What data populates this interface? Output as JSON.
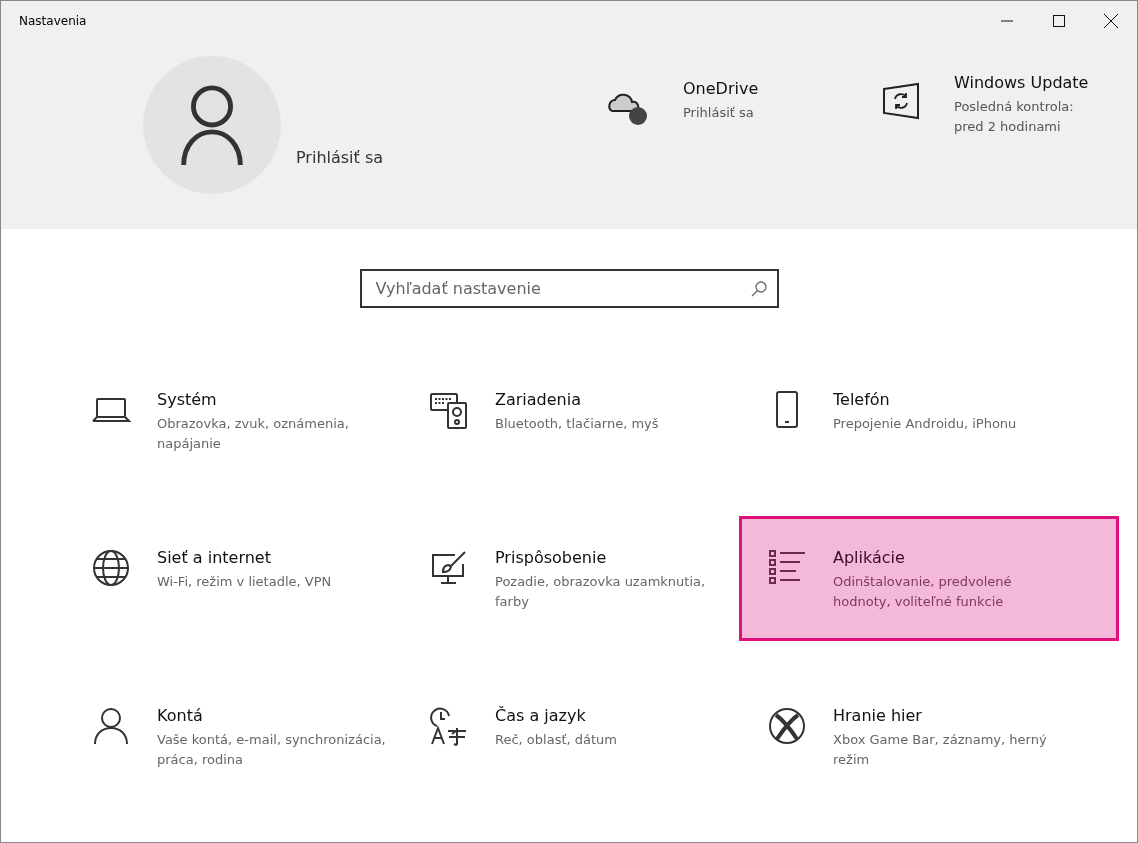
{
  "window": {
    "title": "Nastavenia"
  },
  "account": {
    "label": "Prihlásiť sa"
  },
  "status_items": [
    {
      "kind": "onedrive",
      "title": "OneDrive",
      "detail": "Prihlásiť sa"
    },
    {
      "kind": "update",
      "title": "Windows Update",
      "detail": "Posledná kontrola: pred 2 hodinami"
    }
  ],
  "search": {
    "placeholder": "Vyhľadať nastavenie"
  },
  "categories": [
    {
      "kind": "system",
      "title": "Systém",
      "description": "Obrazovka, zvuk, oznámenia, napájanie",
      "selected": false
    },
    {
      "kind": "devices",
      "title": "Zariadenia",
      "description": "Bluetooth, tlačiarne, myš",
      "selected": false
    },
    {
      "kind": "phone",
      "title": "Telefón",
      "description": "Prepojenie Androidu, iPhonu",
      "selected": false
    },
    {
      "kind": "network",
      "title": "Sieť a internet",
      "description": "Wi-Fi, režim v lietadle, VPN",
      "selected": false
    },
    {
      "kind": "personalization",
      "title": "Prispôsobenie",
      "description": "Pozadie, obrazovka uzamknutia, farby",
      "selected": false
    },
    {
      "kind": "apps",
      "title": "Aplikácie",
      "description": "Odinštalovanie, predvolené hodnoty, voliteľné funkcie",
      "selected": true
    },
    {
      "kind": "accounts",
      "title": "Kontá",
      "description": "Vaše kontá, e-mail, synchronizácia, práca, rodina",
      "selected": false
    },
    {
      "kind": "time",
      "title": "Čas a jazyk",
      "description": "Reč, oblasť, dátum",
      "selected": false
    },
    {
      "kind": "gaming",
      "title": "Hranie hier",
      "description": "Xbox Game Bar, záznamy, herný režim",
      "selected": false
    }
  ]
}
